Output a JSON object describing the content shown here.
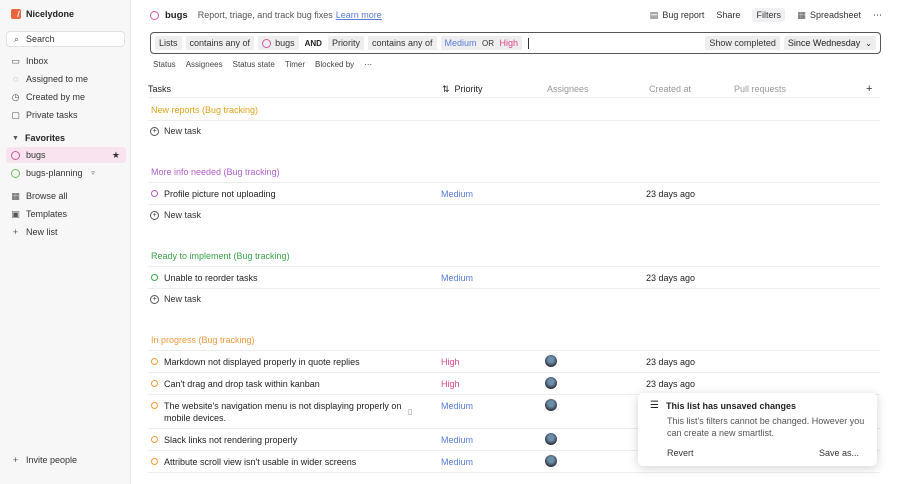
{
  "sidebar": {
    "workspace": "Nicelydone",
    "search": "Search",
    "items": [
      {
        "label": "Inbox",
        "icon": "inbox-icon"
      },
      {
        "label": "Assigned to me",
        "icon": "user-icon"
      },
      {
        "label": "Created by me",
        "icon": "clock-icon"
      },
      {
        "label": "Private tasks",
        "icon": "lock-icon"
      }
    ],
    "favorites_label": "Favorites",
    "favorites": [
      {
        "label": "bugs",
        "active": true
      },
      {
        "label": "bugs-planning",
        "active": false
      }
    ],
    "bottom": [
      {
        "label": "Browse all",
        "icon": "grid-icon"
      },
      {
        "label": "Templates",
        "icon": "template-icon"
      },
      {
        "label": "New list",
        "icon": "plus-icon"
      }
    ],
    "invite": "Invite people"
  },
  "topbar": {
    "title": "bugs",
    "description": "Report, triage, and track bug fixes",
    "learn_more": "Learn more",
    "bug_report": "Bug report",
    "share": "Share",
    "filters": "Filters",
    "spreadsheet": "Spreadsheet",
    "more": "⋯"
  },
  "filter": {
    "field1": "Lists",
    "op1": "contains any of",
    "val1": "bugs",
    "and": "AND",
    "field2": "Priority",
    "op2": "contains any of",
    "val2a": "Medium",
    "or": "OR",
    "val2b": "High",
    "show_completed": "Show completed",
    "since": "Since Wednesday"
  },
  "subfilters": [
    "Status",
    "Assignees",
    "Status state",
    "Timer",
    "Blocked by",
    "⋯"
  ],
  "columns": {
    "tasks": "Tasks",
    "priority": "Priority",
    "assignees": "Assignees",
    "created_at": "Created at",
    "pull_requests": "Pull requests"
  },
  "new_task": "New task",
  "groups": [
    {
      "label": "New reports (Bug tracking)",
      "color": "#e0a21b"
    },
    {
      "label": "More info needed (Bug tracking)",
      "color": "#b25fc9"
    },
    {
      "label": "Ready to implement (Bug tracking)",
      "color": "#3aa648"
    },
    {
      "label": "In progress (Bug tracking)",
      "color": "#f09a3e"
    }
  ],
  "rows": {
    "more_info": [
      {
        "title": "Profile picture not uploading",
        "priority": "Medium",
        "created": "23 days ago"
      }
    ],
    "ready": [
      {
        "title": "Unable to reorder tasks",
        "priority": "Medium",
        "created": "23 days ago"
      }
    ],
    "in_progress": [
      {
        "title": "Markdown not displayed properly in quote replies",
        "priority": "High",
        "created": "23 days ago"
      },
      {
        "title": "Can't drag and drop task within kanban",
        "priority": "High",
        "created": "23 days ago"
      },
      {
        "title": "The website's navigation menu is not displaying properly on mobile devices.",
        "priority": "Medium",
        "created": ""
      },
      {
        "title": "Slack links not rendering properly",
        "priority": "Medium",
        "created": ""
      },
      {
        "title": "Attribute scroll view isn't usable in wider screens",
        "priority": "Medium",
        "created": ""
      }
    ]
  },
  "colors": {
    "medium": "#5a7bd8",
    "high": "#d9478a",
    "accent": "#d45aa0"
  },
  "popup": {
    "title": "This list has unsaved changes",
    "body": "This list's filters cannot be changed. However you can create a new smartlist.",
    "revert": "Revert",
    "save_as": "Save as..."
  }
}
